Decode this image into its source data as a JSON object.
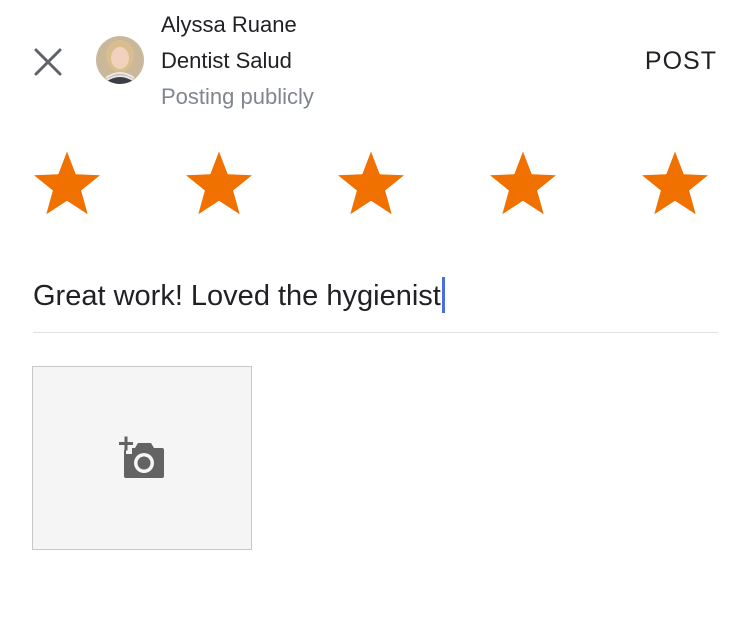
{
  "header": {
    "user_name": "Alyssa Ruane",
    "place_name": "Dentist Salud",
    "visibility": "Posting publicly",
    "post_label": "POST",
    "close_icon": "close-icon"
  },
  "rating": {
    "value": 5,
    "max": 5,
    "star_color": "#f07000",
    "icon": "star-icon"
  },
  "review": {
    "text": "Great work! Loved the hygienist"
  },
  "photo": {
    "icon": "add-photo-icon"
  },
  "colors": {
    "text": "#202124",
    "secondary_text": "#80868b",
    "caret": "#4a6ee0",
    "photo_bg": "#f5f5f5"
  }
}
